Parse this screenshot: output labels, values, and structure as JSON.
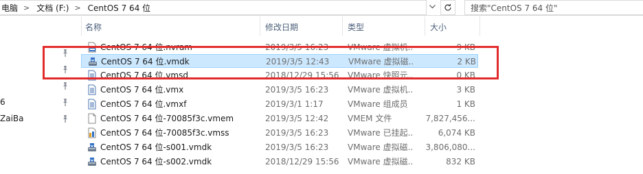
{
  "address": {
    "crumbs": [
      "电脑",
      "文档 (F:)",
      "CentOS 7 64 位"
    ],
    "separator": ">"
  },
  "search": {
    "placeholder": "搜索\"CentOS 7 64 位\""
  },
  "nav": {
    "items": [
      "6",
      "ZaiBa"
    ]
  },
  "columns": {
    "name": "名称",
    "date": "修改日期",
    "type": "类型",
    "size": "大小"
  },
  "files": [
    {
      "name": "CentOS 7 64 位.nvram",
      "date": "2019/3/5 16:23",
      "type": "VMware 虚拟机...",
      "size": "9 KB",
      "icon": "nvram-file-icon"
    },
    {
      "name": "CentOS 7 64 位.vmdk",
      "date": "2019/3/5 12:43",
      "type": "VMware 虚拟磁...",
      "size": "2 KB",
      "icon": "virtual-disk-icon"
    },
    {
      "name": "CentOS 7 64 位.vmsd",
      "date": "2018/12/29 15:56",
      "type": "VMware 快照元...",
      "size": "0 KB",
      "icon": "document-icon"
    },
    {
      "name": "CentOS 7 64 位.vmx",
      "date": "2019/3/5 16:23",
      "type": "VMware 虚拟机...",
      "size": "3 KB",
      "icon": "document-icon"
    },
    {
      "name": "CentOS 7 64 位.vmxf",
      "date": "2019/3/1 1:17",
      "type": "VMware 组成员",
      "size": "1 KB",
      "icon": "document-icon"
    },
    {
      "name": "CentOS 7 64 位-70085f3c.vmem",
      "date": "2019/3/5 12:42",
      "type": "VMEM 文件",
      "size": "7,827,456...",
      "icon": "blank-file-icon"
    },
    {
      "name": "CentOS 7 64 位-70085f3c.vmss",
      "date": "2019/3/5 16:23",
      "type": "VMware 已挂起...",
      "size": "6,074 KB",
      "icon": "suspended-state-icon"
    },
    {
      "name": "CentOS 7 64 位-s001.vmdk",
      "date": "2019/3/5 16:23",
      "type": "VMware 虚拟磁...",
      "size": "3,806,080...",
      "icon": "virtual-disk-icon"
    },
    {
      "name": "CentOS 7 64 位-s002.vmdk",
      "date": "2018/12/29 15:56",
      "type": "VMware 虚拟磁...",
      "size": "832 KB",
      "icon": "virtual-disk-icon"
    }
  ],
  "selected_index": 1,
  "highlight_color": "#e22a2a"
}
